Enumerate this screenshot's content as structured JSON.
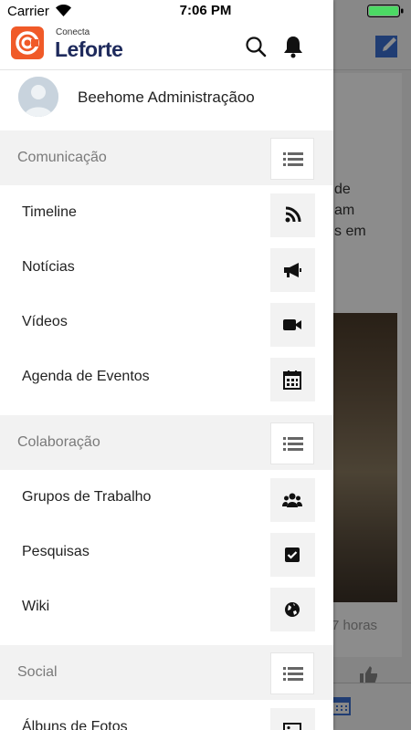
{
  "status_bar": {
    "carrier": "Carrier",
    "time": "7:06 PM"
  },
  "background": {
    "card_text_lines": [
      "de",
      "am",
      "s em"
    ],
    "time_ago": "7 horas"
  },
  "drawer": {
    "logo": {
      "small_text": "Conecta",
      "big_text": "Leforte",
      "color": "#f05a28"
    },
    "header_icons": [
      "search-icon",
      "bell-icon"
    ],
    "profile": {
      "name": "Beehome Administraçãoo"
    },
    "sections": [
      {
        "label": "Comunicação",
        "icon": "list-icon",
        "items": [
          {
            "label": "Timeline",
            "icon": "rss-icon"
          },
          {
            "label": "Notícias",
            "icon": "megaphone-icon"
          },
          {
            "label": "Vídeos",
            "icon": "video-camera-icon"
          },
          {
            "label": "Agenda de Eventos",
            "icon": "calendar-icon"
          }
        ]
      },
      {
        "label": "Colaboração",
        "icon": "list-icon",
        "items": [
          {
            "label": "Grupos de Trabalho",
            "icon": "users-icon"
          },
          {
            "label": "Pesquisas",
            "icon": "checkbox-icon"
          },
          {
            "label": "Wiki",
            "icon": "globe-icon"
          }
        ]
      },
      {
        "label": "Social",
        "icon": "list-icon",
        "items": [
          {
            "label": "Álbuns de Fotos",
            "icon": "image-icon"
          }
        ]
      }
    ]
  },
  "colors": {
    "accent_blue": "#3b6fd1",
    "logo_orange": "#f05a28",
    "brand_navy": "#1e2a5c",
    "section_bg": "#f2f2f2"
  }
}
